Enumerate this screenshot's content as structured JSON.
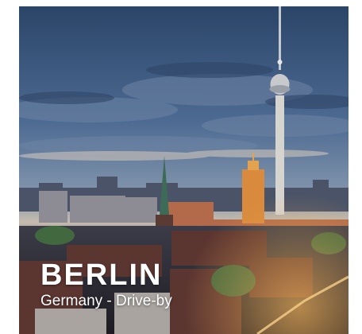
{
  "card": {
    "city": "BERLIN",
    "subtitle": "Germany - Drive-by"
  },
  "image": {
    "subject": "berlin-skyline-photo",
    "colors": {
      "sky_top": "#2f4a6e",
      "sky_mid": "#5c7394",
      "horizon": "#c9b8a6",
      "city_dark": "#2c2a33",
      "lights": "#e8a24a"
    }
  }
}
